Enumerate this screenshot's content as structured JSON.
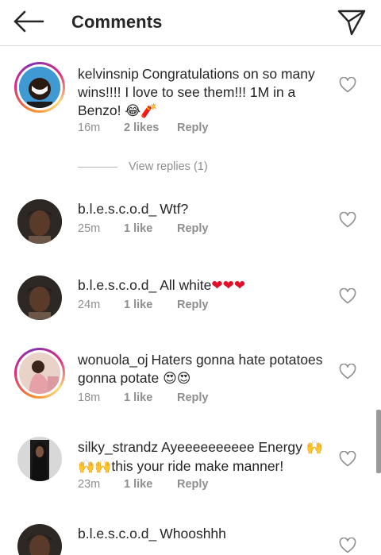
{
  "header": {
    "title": "Comments",
    "back_icon": "arrow-left-icon",
    "share_icon": "paper-plane-icon"
  },
  "comments": [
    {
      "username": "kelvinsnip",
      "text": "Congratulations on so many wins!!!! I love to see them!!! 1M in a Benzo!",
      "emoji": "😂🧨",
      "time": "16m",
      "likes": "2 likes",
      "reply": "Reply",
      "story_ring": true
    },
    {
      "username": "b.l.e.s.c.o.d_",
      "text": "Wtf?",
      "time": "25m",
      "likes": "1 like",
      "reply": "Reply",
      "story_ring": false
    },
    {
      "username": "b.l.e.s.c.o.d_",
      "text": "All white",
      "emoji": "❤❤❤",
      "time": "24m",
      "likes": "1 like",
      "reply": "Reply",
      "story_ring": false
    },
    {
      "username": "wonuola_oj",
      "text": "Haters gonna hate potatoes gonna potate",
      "emoji": "😍😍",
      "time": "18m",
      "likes": "1 like",
      "reply": "Reply",
      "story_ring": true
    },
    {
      "username": "silky_strandz",
      "text": "Ayeeeeeeeeee Energy",
      "emoji": "🙌🙌🙌",
      "text2": "this your ride make manner!",
      "time": "23m",
      "likes": "1 like",
      "reply": "Reply",
      "story_ring": false
    },
    {
      "username": "b.l.e.s.c.o.d_",
      "text": "Whooshhh",
      "story_ring": false
    }
  ],
  "view_replies": "View replies (1)",
  "colors": {
    "text": "#262626",
    "meta": "#8e8e8e",
    "divider": "#dbdbdb",
    "heart_red": "#e0102a"
  }
}
